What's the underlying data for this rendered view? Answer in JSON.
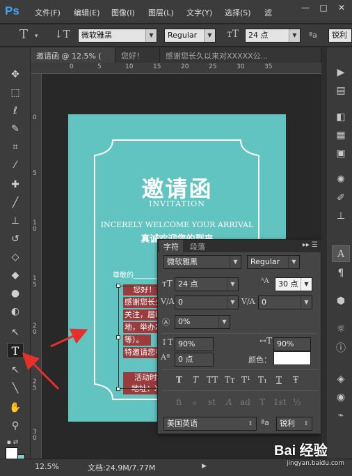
{
  "app": {
    "logo": "Ps"
  },
  "menu": [
    "文件(F)",
    "编辑(E)",
    "图像(I)",
    "图层(L)",
    "文字(Y)",
    "选择(S)",
    "滤"
  ],
  "window_buttons": [
    "—",
    "□",
    "✕"
  ],
  "options": {
    "font_family": "微软雅黑",
    "font_style": "Regular",
    "font_size": "24 点",
    "aa_label": "ªa",
    "antialias": "锐利"
  },
  "tabs": [
    {
      "label": "邀请函 @ 12.5% (",
      "active": true
    },
    {
      "label": "您好！",
      "active": false
    },
    {
      "label": "感谢您长久以来对XXXXX公...",
      "active": false
    }
  ],
  "ruler": {
    "top": [
      "0",
      "5",
      "10",
      "15",
      "20",
      "25",
      "30",
      "35"
    ],
    "left": [
      "0",
      "5",
      "1 0",
      "1 5",
      "2 0",
      "2 5",
      "3 0"
    ]
  },
  "document": {
    "title": "邀请函",
    "subtitle": "INVITATION",
    "welcome_en": "INCERELY WELCOME YOUR ARRIVAL",
    "welcome_cn": "真诚欢迎您的到来",
    "respect": "尊敬的_______先生",
    "lines": [
      "您好！",
      "感谢您长久以",
      "关注，届时我公司",
      "地，举办XXXX活",
      "等）。",
      "特邀请您参加",
      "",
      "活动时间",
      "地址：XX"
    ]
  },
  "character_panel": {
    "tabs": [
      "字符",
      "段落"
    ],
    "font_family": "微软雅黑",
    "font_style": "Regular",
    "font_size": "24 点",
    "leading": "30 点",
    "kerning": "0",
    "tracking": "0",
    "vertical_shift_pct": "0%",
    "vertical_scale": "90%",
    "horizontal_scale": "90%",
    "baseline_shift": "0 点",
    "color_label": "颜色：",
    "style_buttons": [
      "T",
      "T",
      "TT",
      "Tт",
      "T¹",
      "T₁",
      "T",
      "Ŧ"
    ],
    "opentype_buttons": [
      "fi",
      "ℴ",
      "st",
      "A",
      "ad",
      "T",
      "1st",
      "½"
    ],
    "language": "美国英语",
    "aa_label": "ªa",
    "antialias": "锐利"
  },
  "status": {
    "zoom": "12.5%",
    "doc_size": "文档:24.9M/7.77M"
  },
  "watermark": {
    "brand": "Bai 经验",
    "url": "jingyan.baidu.com"
  }
}
